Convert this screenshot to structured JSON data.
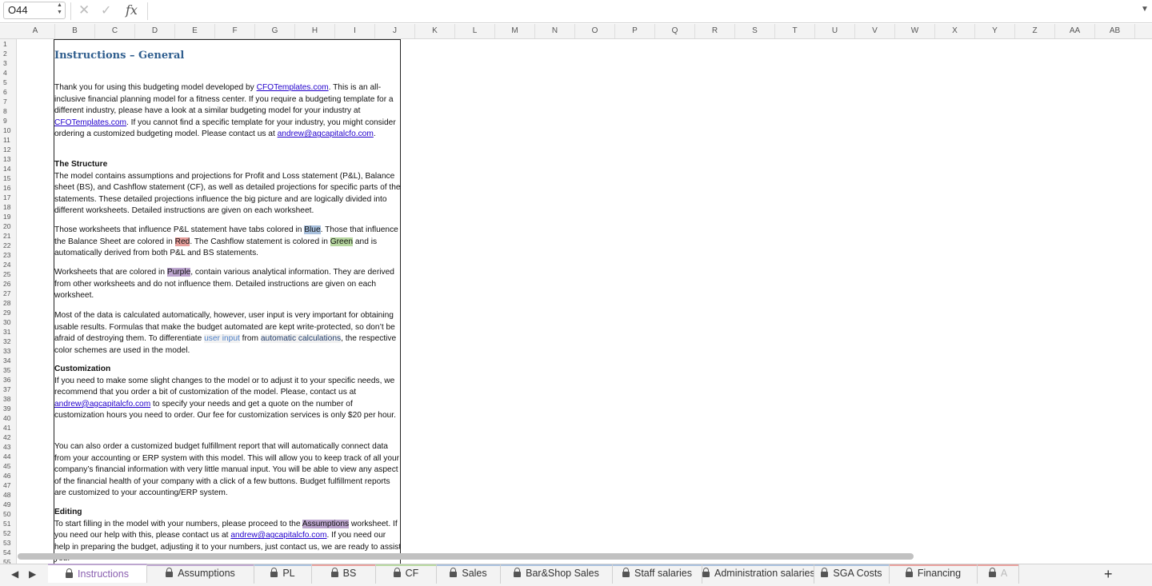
{
  "formula_bar": {
    "cell_ref": "O44",
    "cancel_icon": "x-icon",
    "enter_icon": "check-icon",
    "fx_label": "fx",
    "formula": ""
  },
  "columns": [
    "A",
    "B",
    "C",
    "D",
    "E",
    "F",
    "G",
    "H",
    "I",
    "J",
    "K",
    "L",
    "M",
    "N",
    "O",
    "P",
    "Q",
    "R",
    "S",
    "T",
    "U",
    "V",
    "W",
    "X",
    "Y",
    "Z",
    "AA",
    "AB"
  ],
  "rows": [
    "1",
    "2",
    "3",
    "4",
    "5",
    "6",
    "7",
    "8",
    "9",
    "10",
    "11",
    "12",
    "13",
    "14",
    "15",
    "16",
    "17",
    "18",
    "19",
    "20",
    "21",
    "22",
    "23",
    "24",
    "25",
    "26",
    "27",
    "28",
    "29",
    "30",
    "31",
    "32",
    "33",
    "34",
    "35",
    "36",
    "37",
    "38",
    "39",
    "40",
    "41",
    "42",
    "43",
    "44",
    "45",
    "46",
    "47",
    "48",
    "49",
    "50",
    "51",
    "52",
    "53",
    "54",
    "55"
  ],
  "instructions": {
    "title": "Instructions – General",
    "intro": {
      "t1": "Thank you for using this budgeting model developed by ",
      "link1": "CFOTemplates.com",
      "t2": ". This is an all-inclusive financial planning model for a fitness center. If you require a budgeting template for a different industry, please have a look at a similar budgeting model for your industry at ",
      "link2": "CFOTemplates.com",
      "t3": ". If you cannot find a specific template for your industry, you might consider ordering a customized budgeting model. Please contact us at ",
      "email": "andrew@agcapitalcfo.com",
      "t4": "."
    },
    "structure": {
      "heading": "The Structure",
      "body": "The model contains assumptions and projections for Profit and Loss statement (P&L), Balance sheet (BS), and Cashflow statement (CF), as well as detailed projections for specific parts of the statements. These detailed projections influence the big picture and are logically divided into different worksheets. Detailed instructions are given on each worksheet."
    },
    "colors": {
      "t1": "Those worksheets that influence P&L statement have tabs colored in ",
      "blue": "Blue",
      "t2": ". Those that influence the Balance Sheet are colored in ",
      "red": "Red",
      "t3": ". The Cashflow statement is colored in ",
      "green": "Green",
      "t4": " and is automatically derived from both P&L and BS statements."
    },
    "purple": {
      "t1": "Worksheets that are colored in ",
      "purple": "Purple",
      "t2": ", contain various analytical information. They are derived from other worksheets and do not influence them. Detailed instructions are given on each worksheet."
    },
    "data": {
      "t1": "Most of the data is calculated automatically, however, user input is very important for obtaining usable results. Formulas that make the budget automated are kept write-protected, so don’t be afraid of destroying them. To differentiate ",
      "input": "user input",
      "t2": " from ",
      "auto": "automatic calculations",
      "t3": ", the respective color schemes are used in the model."
    },
    "custom": {
      "heading": "Customization",
      "t1": "If you need to make some slight changes to the model or to adjust it to your specific needs, we recommend that you order a bit of customization of the model. Please, contact us at ",
      "email": "andrew@agcapitalcfo.com",
      "t2": " to specify your needs and get a quote on the number of customization hours you need to order. Our fee for customization services is only $20 per hour."
    },
    "report": {
      "body": "You can also order a customized budget fulfillment report that will automatically connect data from your accounting or ERP system with this model. This will allow you to keep track of all your company’s financial information with very little manual input. You will be able to view any aspect of the financial health of your company with a click of a few buttons. Budget fulfillment reports are customized to your accounting/ERP system."
    },
    "editing": {
      "heading": "Editing",
      "t1": "To start filling in the model with your numbers, please proceed to the ",
      "assumptions": "Assumptions",
      "t2": " worksheet. If you need our help with this, please contact us at ",
      "email": "andrew@agcapitalcfo.com",
      "t3": ". If you need our help in preparing the budget, adjusting it to your numbers, just contact us, we are ready to assist you."
    }
  },
  "tabs": [
    {
      "label": "Instructions",
      "color": "#bda6cf"
    },
    {
      "label": "Assumptions",
      "color": "#bda6cf"
    },
    {
      "label": "PL",
      "color": "#a9c1de"
    },
    {
      "label": "BS",
      "color": "#e8a09d"
    },
    {
      "label": "CF",
      "color": "#b8d8a1"
    },
    {
      "label": "Sales",
      "color": "#a9c1de"
    },
    {
      "label": "Bar&Shop Sales",
      "color": "#a9c1de"
    },
    {
      "label": "Staff salaries",
      "color": "#a9c1de"
    },
    {
      "label": "Administration salaries",
      "color": "#a9c1de"
    },
    {
      "label": "SGA Costs",
      "color": "#a9c1de"
    },
    {
      "label": "Financing",
      "color": "#e8a09d"
    },
    {
      "label": "A",
      "color": "#e8a09d"
    }
  ],
  "add_sheet_label": "+"
}
